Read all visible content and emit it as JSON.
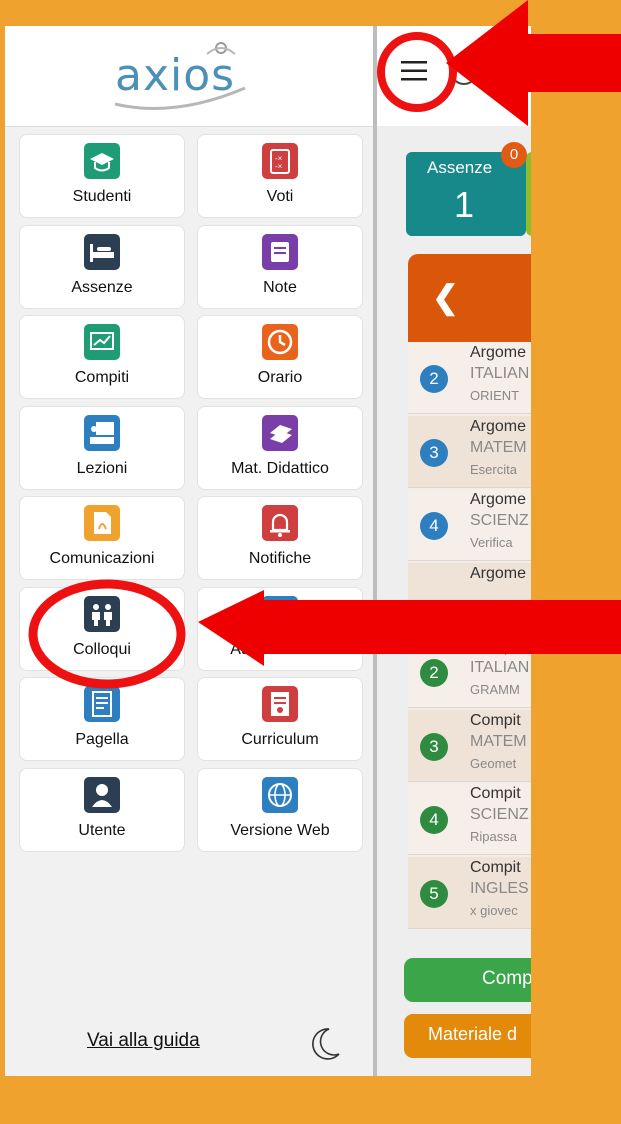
{
  "app": {
    "logo_text": "axios"
  },
  "menu": [
    {
      "label": "Studenti",
      "icon": "graduation-cap-icon",
      "color": "#1e9c76"
    },
    {
      "label": "Voti",
      "icon": "grade-sheet-icon",
      "color": "#cf3f3f"
    },
    {
      "label": "Assenze",
      "icon": "bed-icon",
      "color": "#2b3e52"
    },
    {
      "label": "Note",
      "icon": "note-icon",
      "color": "#7a3ea9"
    },
    {
      "label": "Compiti",
      "icon": "chart-board-icon",
      "color": "#1e9c76"
    },
    {
      "label": "Orario",
      "icon": "clock-icon",
      "color": "#e8641c"
    },
    {
      "label": "Lezioni",
      "icon": "teacher-board-icon",
      "color": "#2d7fc0"
    },
    {
      "label": "Mat. Didattico",
      "icon": "books-icon",
      "color": "#7a3ea9"
    },
    {
      "label": "Comunicazioni",
      "icon": "pdf-document-icon",
      "color": "#f0a22e"
    },
    {
      "label": "Notifiche",
      "icon": "bell-icon",
      "color": "#cf3f3f"
    },
    {
      "label": "Colloqui",
      "icon": "meeting-people-icon",
      "color": "#2b3e52"
    },
    {
      "label": "Autorizzazioni",
      "icon": "authorization-icon",
      "color": "#2d7fc0"
    },
    {
      "label": "Pagella",
      "icon": "report-card-icon",
      "color": "#2d7fc0"
    },
    {
      "label": "Curriculum",
      "icon": "certificate-icon",
      "color": "#cf3f3f"
    },
    {
      "label": "Utente",
      "icon": "user-icon",
      "color": "#2b3e52"
    },
    {
      "label": "Versione Web",
      "icon": "globe-icon",
      "color": "#2d7fc0"
    }
  ],
  "footer": {
    "guide_link": "Vai alla guida"
  },
  "dashboard": {
    "absences_label": "Assenze",
    "absences_value": "1",
    "badge_value": "0",
    "rows": [
      {
        "num": "2",
        "color": "#2d7fc0",
        "a": "Argome",
        "b": "ITALIAN",
        "c": "ORIENT"
      },
      {
        "num": "3",
        "color": "#2d7fc0",
        "a": "Argome",
        "b": "MATEM",
        "c": "Esercita"
      },
      {
        "num": "4",
        "color": "#2d7fc0",
        "a": "Argome",
        "b": "SCIENZ",
        "c": "Verifica"
      },
      {
        "num": "",
        "color": "#2d7fc0",
        "a": "Argome",
        "b": "",
        "c": ""
      },
      {
        "num": "2",
        "color": "#2e8b3f",
        "a": "Compit",
        "b": "ITALIAN",
        "c": "GRAMM"
      },
      {
        "num": "3",
        "color": "#2e8b3f",
        "a": "Compit",
        "b": "MATEM",
        "c": "Geomet"
      },
      {
        "num": "4",
        "color": "#2e8b3f",
        "a": "Compit",
        "b": "SCIENZ",
        "c": "Ripassa"
      },
      {
        "num": "5",
        "color": "#2e8b3f",
        "a": "Compit",
        "b": "INGLES",
        "c": "x giovec"
      }
    ],
    "green_button": "Comp",
    "orange_button": "Materiale d"
  }
}
